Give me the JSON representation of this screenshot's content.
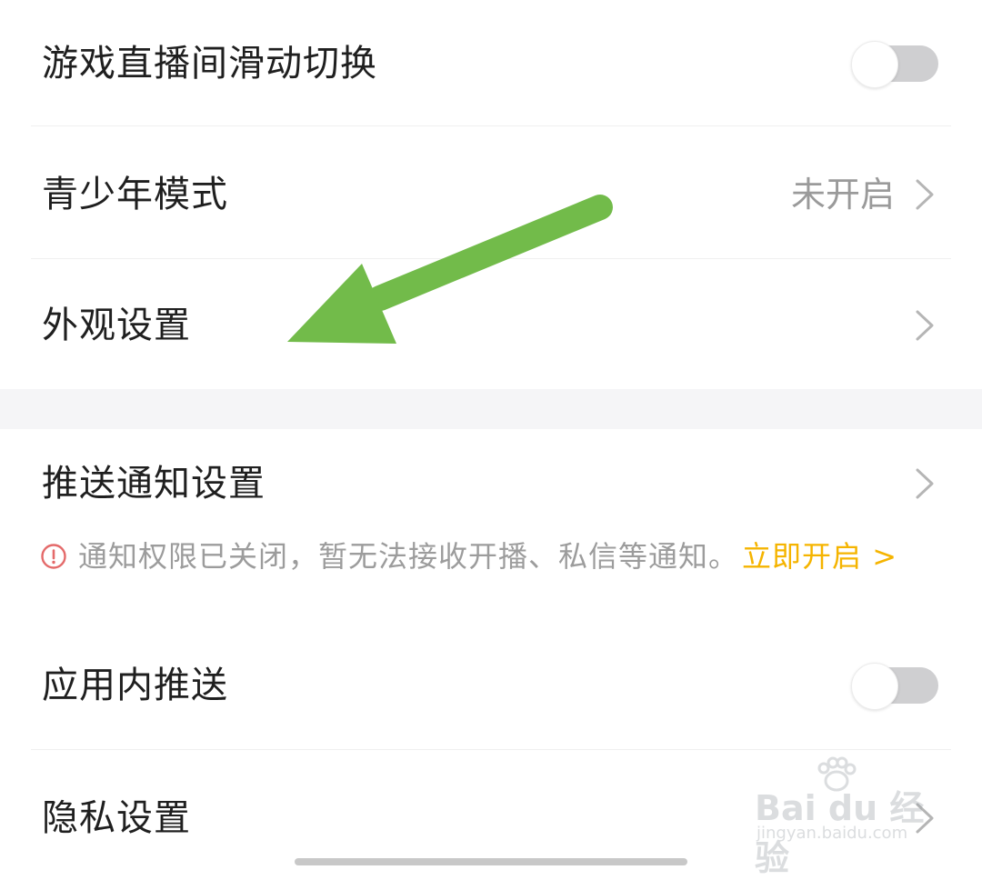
{
  "settings": {
    "items": [
      {
        "label": "游戏直播间滑动切换",
        "control": "toggle",
        "toggle_on": false
      },
      {
        "label": "青少年模式",
        "control": "value-chevron",
        "value": "未开启"
      },
      {
        "label": "外观设置",
        "control": "chevron"
      },
      {
        "label": "推送通知设置",
        "control": "chevron"
      },
      {
        "label": "应用内推送",
        "control": "toggle",
        "toggle_on": false
      },
      {
        "label": "隐私设置",
        "control": "chevron"
      }
    ],
    "notification_warning": {
      "text": "通知权限已关闭，暂无法接收开播、私信等通知。",
      "link": "立即开启 >"
    }
  },
  "colors": {
    "text_primary": "#1f1f1f",
    "text_secondary": "#9a9a9a",
    "link_accent": "#f5b400",
    "warning_red": "#e46a6a",
    "toggle_off_track": "#cfcfd1",
    "annotation_arrow": "#72bb4a",
    "section_gap": "#f5f5f7"
  },
  "annotation": {
    "arrow_icon": "green-arrow-pointing-to-appearance-settings"
  },
  "watermark": {
    "logo_text": "Bai du 经验",
    "url": "jingyan.baidu.com"
  }
}
